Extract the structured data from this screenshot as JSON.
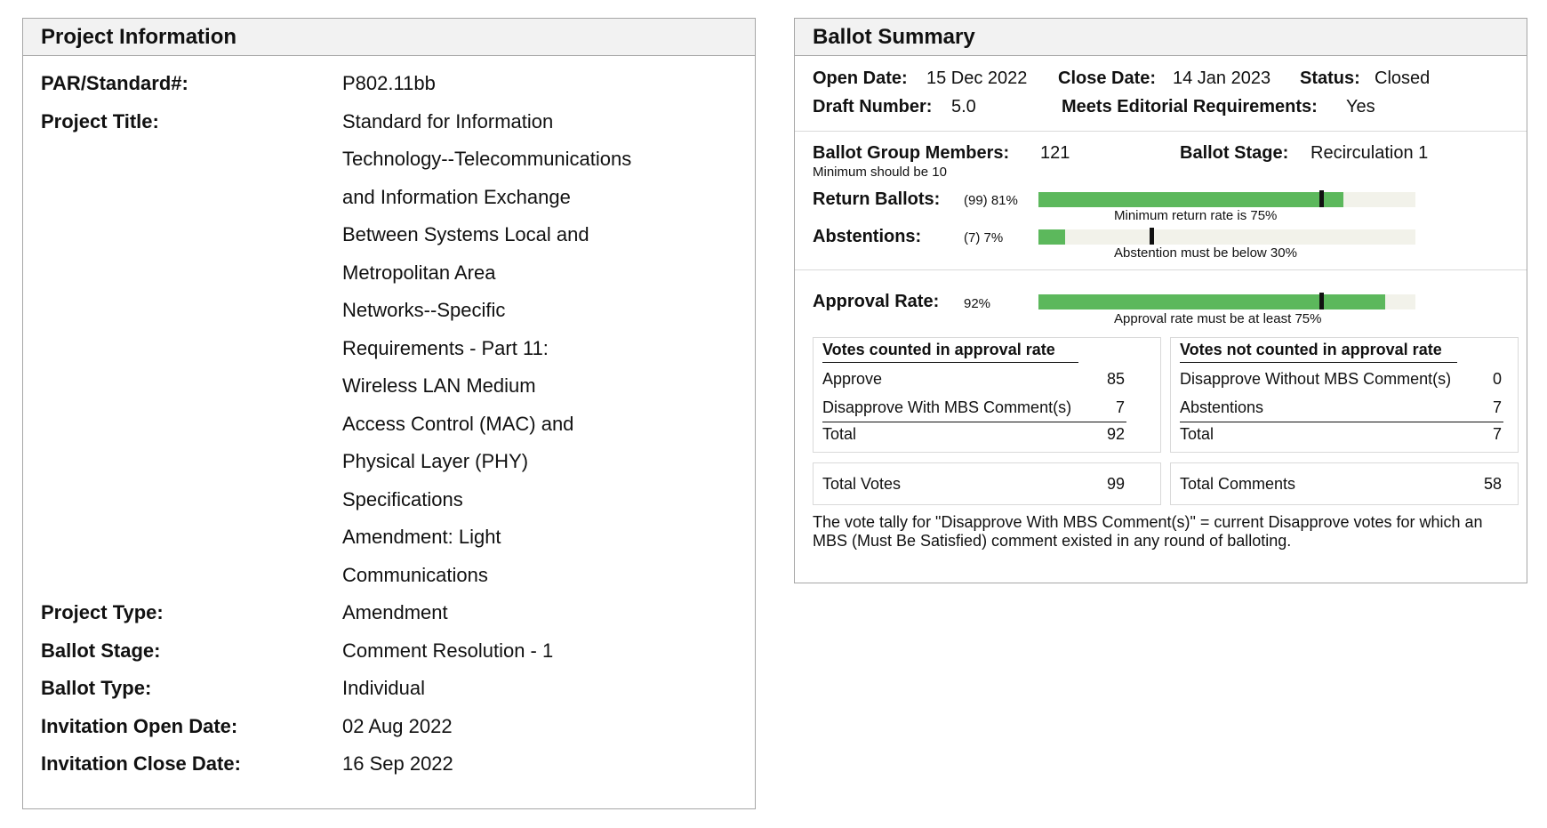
{
  "project": {
    "title": "Project Information",
    "rows": [
      {
        "label": "PAR/Standard#:",
        "value": "P802.11bb"
      },
      {
        "label": "Project Title:",
        "value_lines": [
          "Standard for Information",
          "Technology--Telecommunications",
          "and Information Exchange",
          "Between Systems Local and",
          "Metropolitan Area",
          "Networks--Specific",
          "Requirements - Part 11:",
          "Wireless LAN Medium",
          "Access Control (MAC) and",
          "Physical Layer (PHY)",
          "Specifications",
          "Amendment: Light",
          "Communications"
        ]
      },
      {
        "label": "Project Type:",
        "value": "Amendment"
      },
      {
        "label": "Ballot Stage:",
        "value": "Comment Resolution - 1"
      },
      {
        "label": "Ballot Type:",
        "value": "Individual"
      },
      {
        "label": "Invitation Open Date:",
        "value": "02 Aug 2022"
      },
      {
        "label": "Invitation Close Date:",
        "value": "16 Sep 2022"
      }
    ]
  },
  "ballot": {
    "title": "Ballot Summary",
    "open_date_label": "Open Date:",
    "open_date": "15 Dec 2022",
    "close_date_label": "Close Date:",
    "close_date": "14 Jan 2023",
    "status_label": "Status:",
    "status": "Closed",
    "draft_label": "Draft Number:",
    "draft": "5.0",
    "editorial_label": "Meets Editorial Requirements:",
    "editorial": "Yes",
    "members_label": "Ballot Group Members:",
    "members": "121",
    "members_note": "Minimum should be 10",
    "stage_label": "Ballot Stage:",
    "stage": "Recirculation 1",
    "return_label": "Return Ballots:",
    "return_value": "(99) 81%",
    "return_fraction": 0.81,
    "return_threshold": 0.75,
    "return_note": "Minimum return rate is 75%",
    "abstain_label": "Abstentions:",
    "abstain_value": "(7) 7%",
    "abstain_fraction": 0.07,
    "abstain_threshold": 0.3,
    "abstain_note": "Abstention must be below 30%",
    "approval_label": "Approval Rate:",
    "approval_value": "92%",
    "approval_fraction": 0.92,
    "approval_threshold": 0.75,
    "approval_note": "Approval rate must be at least 75%",
    "counted": {
      "title": "Votes counted in approval rate",
      "rows": [
        {
          "label": "Approve",
          "value": "85"
        },
        {
          "label": "Disapprove With MBS Comment(s)",
          "value": "7"
        }
      ],
      "total_label": "Total",
      "total": "92"
    },
    "not_counted": {
      "title": "Votes not counted in approval rate",
      "rows": [
        {
          "label": "Disapprove Without MBS Comment(s)",
          "value": "0"
        },
        {
          "label": "Abstentions",
          "value": "7"
        }
      ],
      "total_label": "Total",
      "total": "7"
    },
    "total_votes_label": "Total Votes",
    "total_votes": "99",
    "total_comments_label": "Total Comments",
    "total_comments": "58",
    "footnote": "The vote tally for \"Disapprove With MBS Comment(s)\" = current Disapprove votes for which an MBS (Must Be Satisfied) comment existed in any round of balloting.",
    "colors": {
      "bar_fill": "#5cb85c",
      "bar_track": "#f2f2ea",
      "marker": "#111111"
    }
  }
}
